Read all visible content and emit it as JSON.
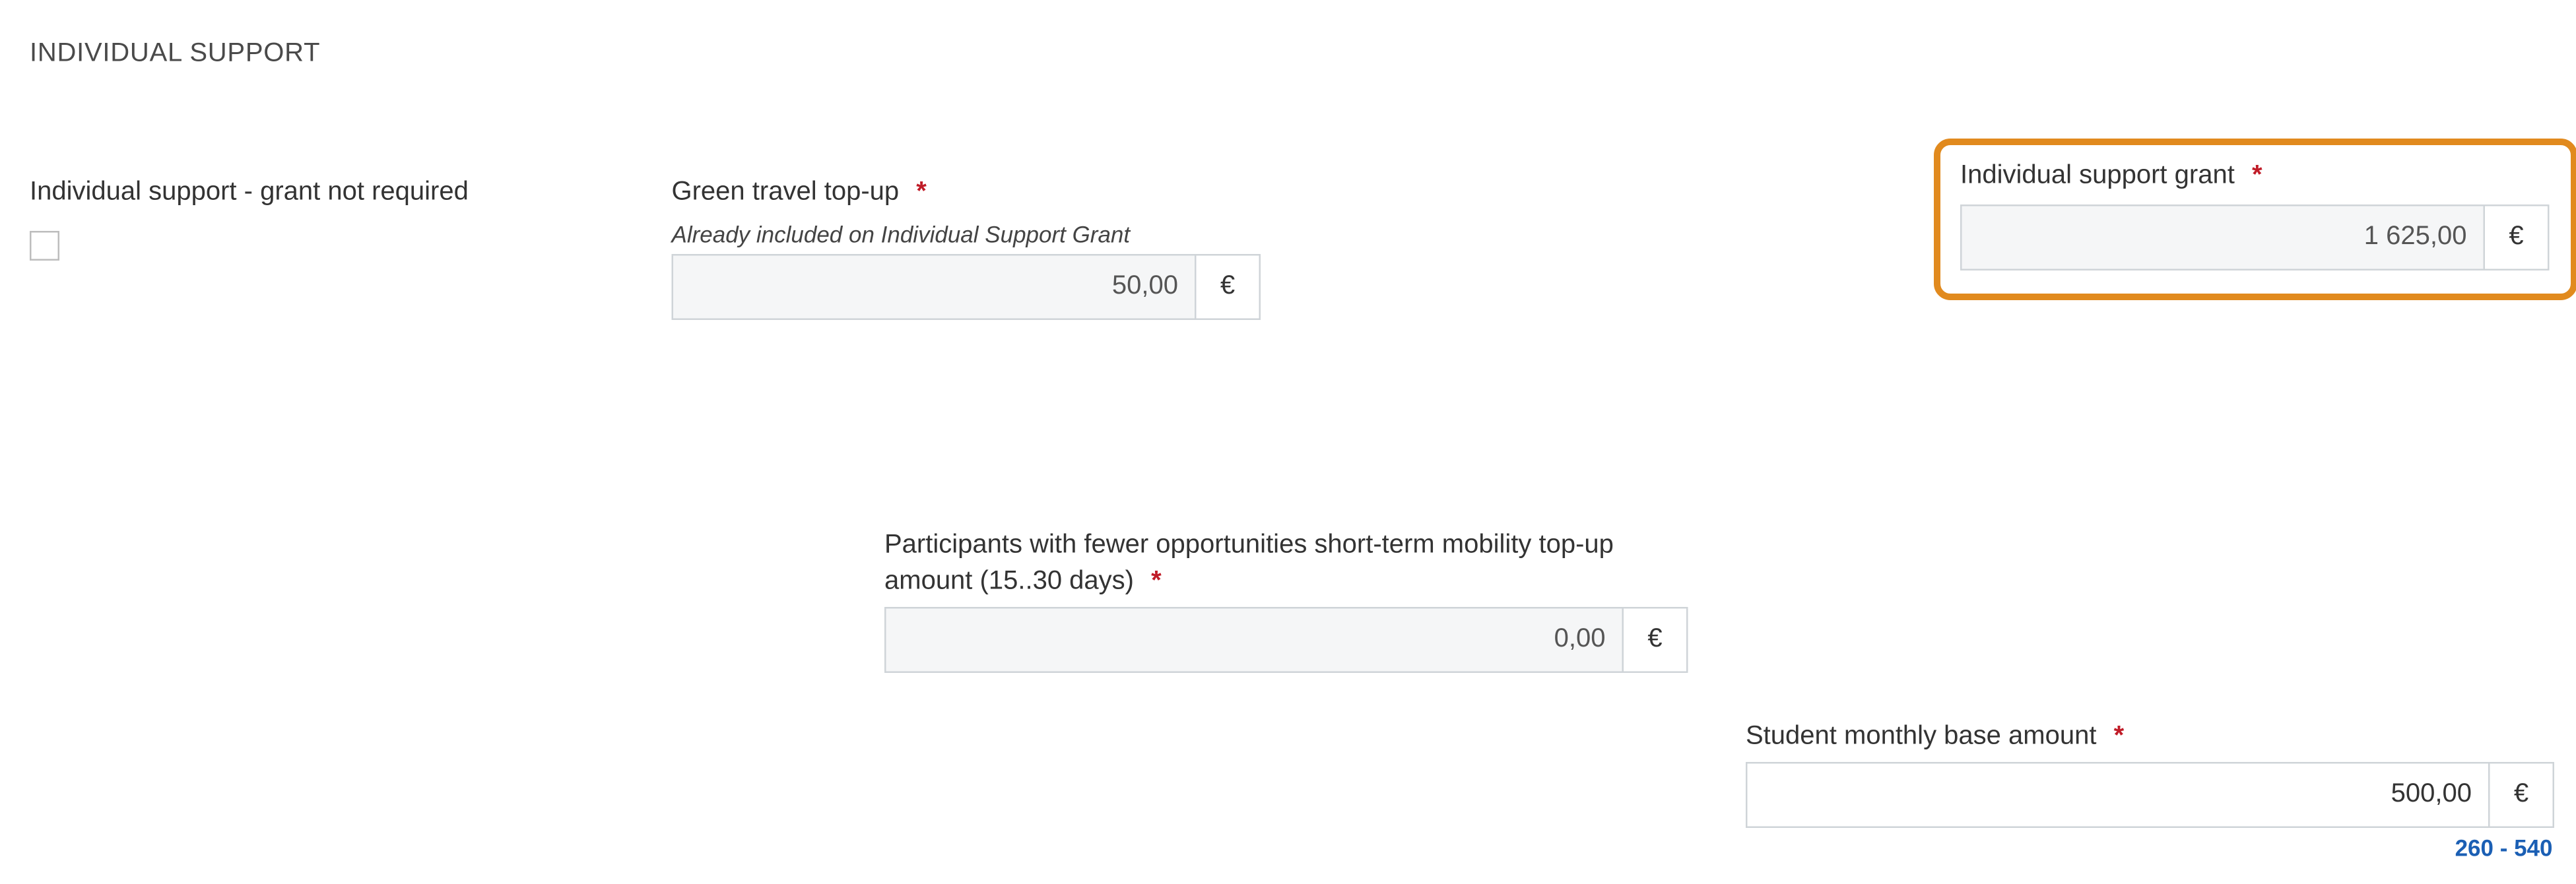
{
  "section": {
    "title": "INDIVIDUAL SUPPORT"
  },
  "grantNotRequired": {
    "label": "Individual support - grant not required"
  },
  "greenTopup": {
    "label": "Green travel top-up",
    "hint": "Already included on Individual Support Grant",
    "value": "50,00"
  },
  "individualSupportGrant": {
    "label": "Individual support grant",
    "value": "1 625,00"
  },
  "fewerOppTopup": {
    "label": "Participants with fewer opportunities short-term mobility top-up amount (15..30 days)",
    "value": "0,00"
  },
  "monthlyBase": {
    "label": "Student monthly base amount",
    "value": "500,00",
    "range": "260 - 540"
  },
  "currency": {
    "symbol": "€"
  }
}
